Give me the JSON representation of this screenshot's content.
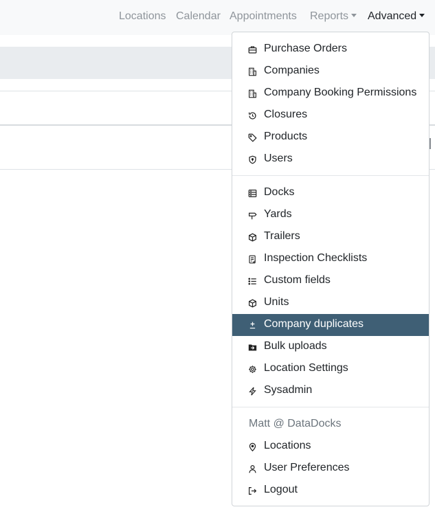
{
  "navbar": {
    "items": [
      {
        "label": "Locations"
      },
      {
        "label": "Calendar"
      },
      {
        "label": "Appointments"
      },
      {
        "label": "Reports"
      },
      {
        "label": "Advanced"
      }
    ]
  },
  "dropdown": {
    "section1": [
      {
        "label": "Purchase Orders",
        "icon": "briefcase-icon"
      },
      {
        "label": "Companies",
        "icon": "building-icon"
      },
      {
        "label": "Company Booking Permissions",
        "icon": "building-icon"
      },
      {
        "label": "Closures",
        "icon": "history-icon"
      },
      {
        "label": "Products",
        "icon": "tag-icon"
      },
      {
        "label": "Users",
        "icon": "shield-icon"
      }
    ],
    "section2": [
      {
        "label": "Docks",
        "icon": "dock-icon"
      },
      {
        "label": "Yards",
        "icon": "signpost-icon"
      },
      {
        "label": "Trailers",
        "icon": "box-icon"
      },
      {
        "label": "Inspection Checklists",
        "icon": "checklist-icon"
      },
      {
        "label": "Custom fields",
        "icon": "list-icon"
      },
      {
        "label": "Units",
        "icon": "box-icon"
      },
      {
        "label": "Company duplicates",
        "icon": "plus-minus-icon"
      },
      {
        "label": "Bulk uploads",
        "icon": "folder-upload-icon"
      },
      {
        "label": "Location Settings",
        "icon": "gear-icon"
      },
      {
        "label": "Sysadmin",
        "icon": "lightning-icon"
      }
    ],
    "user_header": "Matt @ DataDocks",
    "section3": [
      {
        "label": "Locations",
        "icon": "location-pin-icon"
      },
      {
        "label": "User Preferences",
        "icon": "person-icon"
      },
      {
        "label": "Logout",
        "icon": "logout-icon"
      }
    ],
    "highlight_color": "#3f5f75"
  }
}
